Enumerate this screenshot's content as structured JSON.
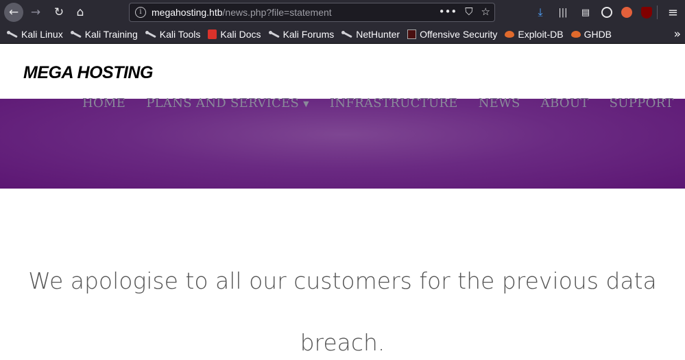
{
  "browser": {
    "url_host": "megahosting.htb",
    "url_path": "/news.php?file=statement",
    "url_actions": [
      "•••",
      "⛉",
      "☆"
    ],
    "bookmarks": [
      {
        "label": "Kali Linux",
        "icon": "kali-dragon-icon"
      },
      {
        "label": "Kali Training",
        "icon": "kali-dragon-icon"
      },
      {
        "label": "Kali Tools",
        "icon": "kali-dragon-icon"
      },
      {
        "label": "Kali Docs",
        "icon": "kali-docs-icon"
      },
      {
        "label": "Kali Forums",
        "icon": "kali-dragon-icon"
      },
      {
        "label": "NetHunter",
        "icon": "kali-dragon-icon"
      },
      {
        "label": "Offensive Security",
        "icon": "offsec-icon"
      },
      {
        "label": "Exploit-DB",
        "icon": "exploitdb-icon"
      },
      {
        "label": "GHDB",
        "icon": "exploitdb-icon"
      }
    ]
  },
  "site": {
    "logo": "MEGA HOSTING",
    "nav": [
      "HOME",
      "PLANS AND SERVICES",
      "INFRASTRUCTURE",
      "NEWS",
      "ABOUT",
      "SUPPORT"
    ],
    "statement_line1": "We apologise to all our customers for the previous data",
    "statement_line2": "breach."
  },
  "colors": {
    "hero": "#6a2a82",
    "nav_text": "#8a8a9a",
    "chrome": "#2b2a33"
  }
}
